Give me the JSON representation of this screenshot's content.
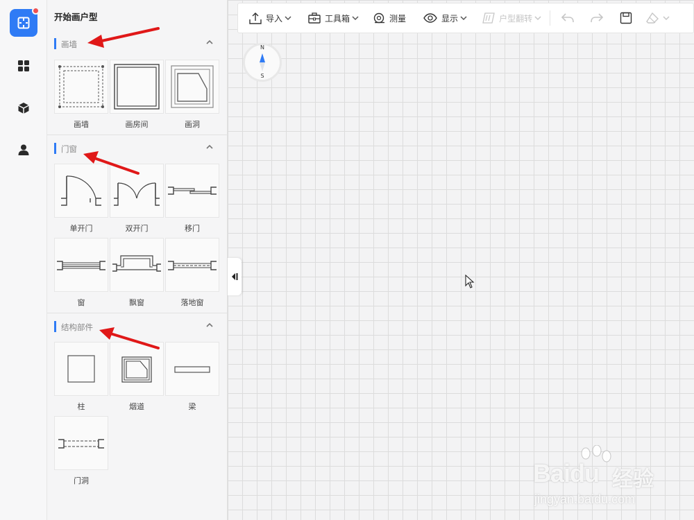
{
  "panel": {
    "title": "开始画户型"
  },
  "sections": {
    "draw_wall": {
      "title": "画墙",
      "items": [
        "画墙",
        "画房间",
        "画洞"
      ]
    },
    "doors_windows": {
      "title": "门窗",
      "items": [
        "单开门",
        "双开门",
        "移门",
        "窗",
        "飘窗",
        "落地窗"
      ]
    },
    "structure": {
      "title": "结构部件",
      "items": [
        "柱",
        "烟道",
        "梁",
        "门洞"
      ]
    }
  },
  "toolbar": {
    "import_label": "导入",
    "toolbox_label": "工具箱",
    "measure_label": "测量",
    "display_label": "显示",
    "flip_label": "户型翻转"
  },
  "compass": {
    "north": "N",
    "south": "S"
  },
  "watermark": {
    "logo": "Baidu",
    "name": "经验",
    "url": "jingyan.baidu.com"
  },
  "colors": {
    "accent": "#2f7bf5",
    "notification": "#f05050",
    "annotation_arrow": "#e01818"
  },
  "icons": [
    "floorplan-icon",
    "apps-icon",
    "cube-icon",
    "user-icon"
  ]
}
